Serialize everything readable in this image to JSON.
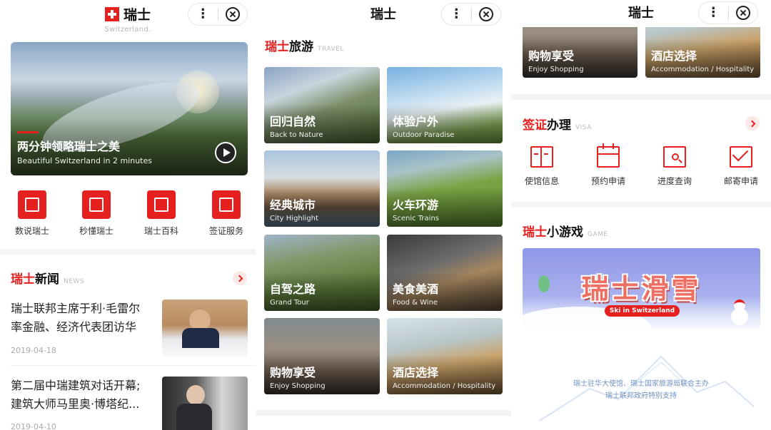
{
  "panel1": {
    "logo_cn": "瑞士",
    "logo_en": "Switzerland.",
    "hero": {
      "title": "两分钟领略瑞士之美",
      "subtitle": "Beautiful Switzerland in 2 minutes"
    },
    "quick_links": [
      {
        "label": "数说瑞士",
        "icon": "chart-book-icon"
      },
      {
        "label": "秒懂瑞士",
        "icon": "play-box-icon"
      },
      {
        "label": "瑞士百科",
        "icon": "book-icon"
      },
      {
        "label": "签证服务",
        "icon": "passport-icon"
      }
    ],
    "news_section": {
      "title_red": "瑞士",
      "title_rest": "新闻",
      "en": "NEWS"
    },
    "news": [
      {
        "line1": "瑞士联邦主席于利·毛雷尔",
        "line2": "率金融、经济代表团访华",
        "date": "2019-04-18"
      },
      {
        "line1": "第二届中瑞建筑对话开幕;",
        "line2": "建筑大师马里奥·博塔纪...",
        "date": "2019-04-10"
      }
    ]
  },
  "panel2": {
    "header_title": "瑞士",
    "travel_section": {
      "title_red": "瑞士",
      "title_rest": "旅游",
      "en": "TRAVEL"
    },
    "tiles": [
      {
        "cn": "回归自然",
        "en": "Back to Nature"
      },
      {
        "cn": "体验户外",
        "en": "Outdoor Paradise"
      },
      {
        "cn": "经典城市",
        "en": "City Highlight"
      },
      {
        "cn": "火车环游",
        "en": "Scenic Trains"
      },
      {
        "cn": "自驾之路",
        "en": "Grand Tour"
      },
      {
        "cn": "美食美酒",
        "en": "Food & Wine"
      },
      {
        "cn": "购物享受",
        "en": "Enjoy Shopping"
      },
      {
        "cn": "酒店选择",
        "en": "Accommodation / Hospitality"
      }
    ]
  },
  "panel3": {
    "header_title": "瑞士",
    "top_tiles": [
      {
        "cn": "购物享受",
        "en": "Enjoy Shopping"
      },
      {
        "cn": "酒店选择",
        "en": "Accommodation / Hospitality"
      }
    ],
    "visa_section": {
      "title_red": "签证",
      "title_rest": "办理",
      "en": "VISA"
    },
    "visa_items": [
      {
        "label": "使馆信息",
        "icon": "building-icon"
      },
      {
        "label": "预约申请",
        "icon": "calendar-icon"
      },
      {
        "label": "进度查询",
        "icon": "search-doc-icon"
      },
      {
        "label": "邮寄申请",
        "icon": "mail-icon"
      }
    ],
    "game_section": {
      "title_red": "瑞士",
      "title_rest": "小游戏",
      "en": "GAME"
    },
    "game_banner": {
      "title": "瑞士滑雪",
      "subtitle": "Ski in Switzerland"
    },
    "footer": {
      "line1": "瑞士驻华大使馆、瑞士国家旅游局联合主办",
      "line2": "瑞士联邦政府特别支持"
    }
  },
  "colors": {
    "accent": "#e6201f",
    "divider": "#f4f4f4",
    "footer_text": "#6f93c4"
  }
}
